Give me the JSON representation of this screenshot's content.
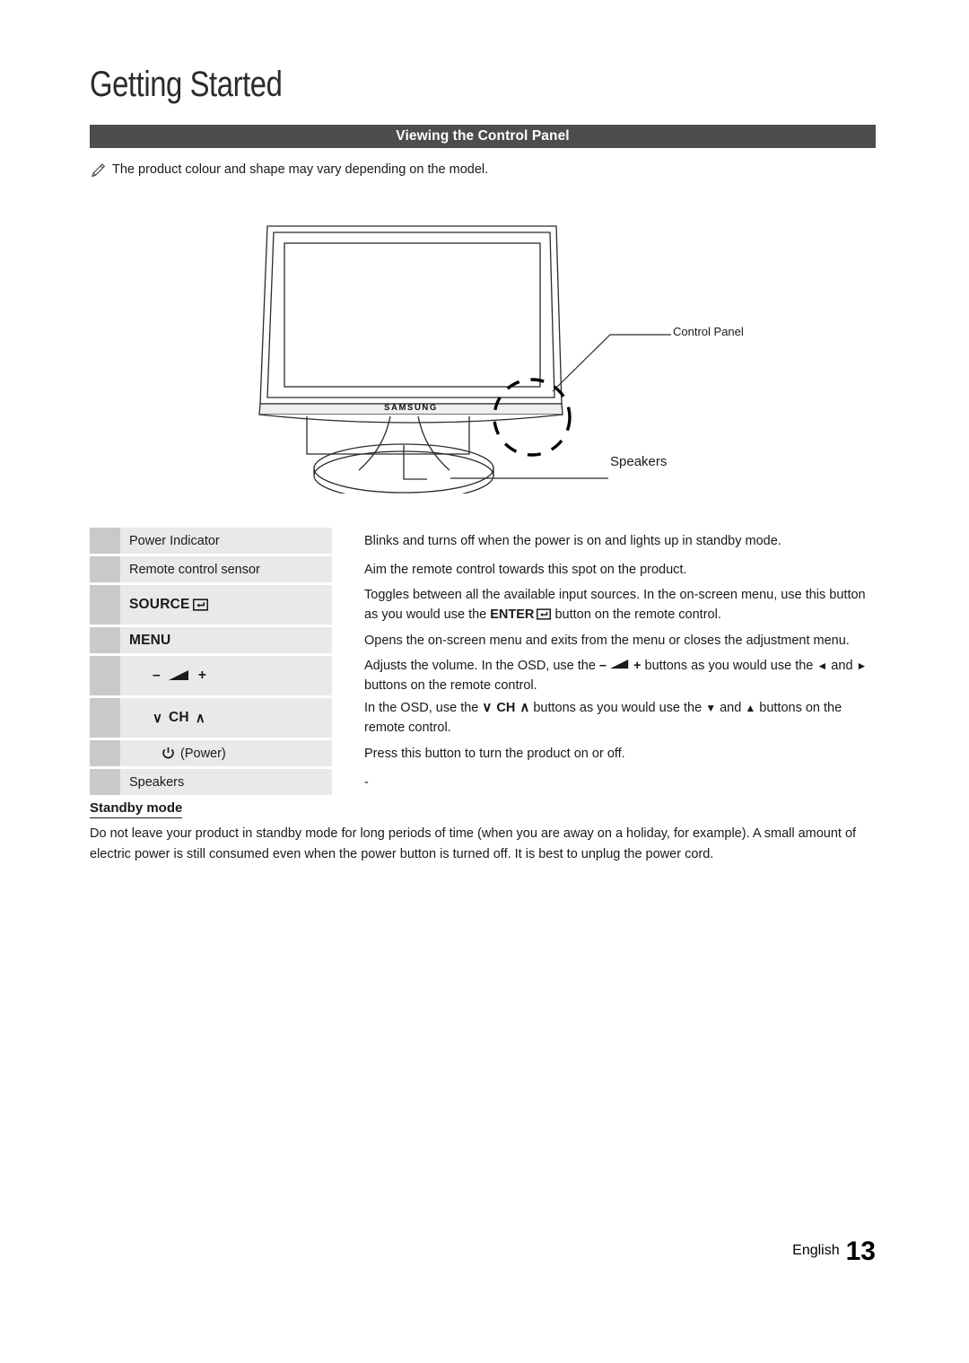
{
  "page": {
    "chapter_title": "Getting Started",
    "section_header": "Viewing the Control Panel",
    "note": "The product colour and shape may vary depending on the model.",
    "note_icon": "pencil-note-icon",
    "footer_language": "English",
    "footer_page_number": "13"
  },
  "illustration": {
    "brand_logo": "SAMSUNG",
    "callouts": [
      {
        "label": "Control Panel"
      },
      {
        "label": "Speakers"
      }
    ],
    "highlight": "dashed-circle-control-panel-area"
  },
  "table": {
    "rows": [
      {
        "swatch": "",
        "label": "Power Indicator",
        "label_style": "plain",
        "description": "Blinks and turns off when the power is on and lights up in standby mode."
      },
      {
        "swatch": "",
        "label": "Remote control sensor",
        "label_style": "plain",
        "description": "Aim the remote control towards this spot on the product."
      },
      {
        "swatch": "",
        "label": "SOURCE",
        "label_style": "bold-with-enter-icon",
        "description_part1": "Toggles between all the available input sources. In the on-screen menu, use this button as you would use the ",
        "description_enter": "ENTER",
        "description_part2": " button on the remote control."
      },
      {
        "swatch": "",
        "label": "MENU",
        "label_style": "bold",
        "description": "Opens the on-screen menu and exits from the menu or closes the adjustment menu."
      },
      {
        "swatch": "",
        "label_minus": "–",
        "label_plus": "+",
        "label_style": "volume-icons",
        "description_part1": "Adjusts the volume. In the OSD, use the ",
        "description_minus": "–",
        "description_plus": "+",
        "description_part2": " buttons as you would use the ",
        "description_left": "◄",
        "description_and": " and ",
        "description_right": "►",
        "description_part3": " buttons on the remote control."
      },
      {
        "swatch": "",
        "label_down": "∨",
        "label_ch": "CH",
        "label_up": "∧",
        "label_style": "channel-icons",
        "description_part1": "In the OSD, use the ",
        "description_down": "∨",
        "description_ch": "CH",
        "description_up": "∧",
        "description_part2": " buttons as you would use the ",
        "description_tri_down": "▼",
        "description_and": " and ",
        "description_tri_up": "▲",
        "description_part3": " buttons on the remote control."
      },
      {
        "swatch": "",
        "label_power_glyph": "⏻",
        "label_power_text": "(Power)",
        "label_style": "power",
        "description": "Press this button to turn the product on or off."
      },
      {
        "swatch": "",
        "label": "Speakers",
        "label_style": "plain",
        "description": "-"
      }
    ]
  },
  "standby": {
    "heading": "Standby mode",
    "body": "Do not leave your product in standby mode for long periods of time (when you are away on a holiday, for example). A small amount of electric power is still consumed even when the power button is turned off. It is best to unplug the power cord."
  },
  "colors": {
    "header_bar": "#4d4d4d",
    "swatch_gray": "#c9c9c9",
    "cell_gray": "#e9e9e9",
    "text": "#1a1a1a"
  }
}
